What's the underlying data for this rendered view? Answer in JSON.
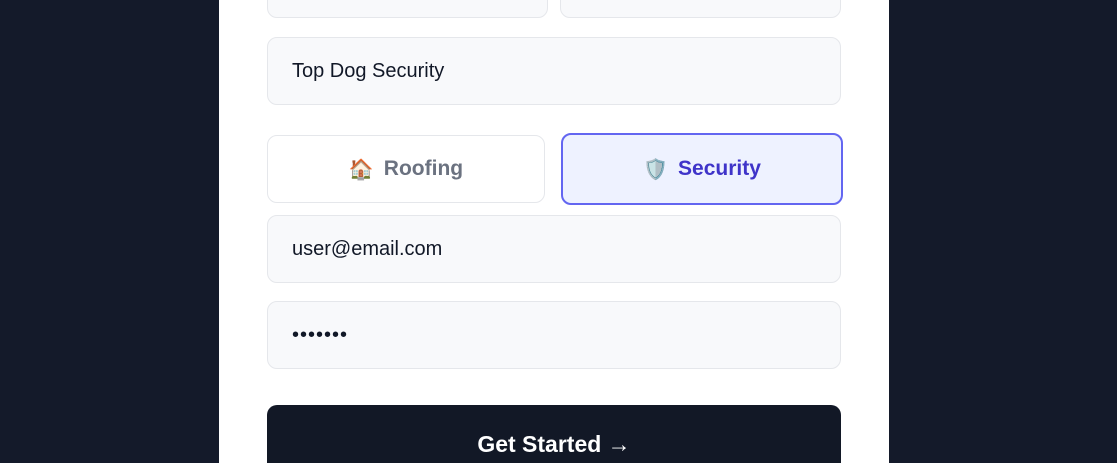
{
  "form": {
    "top_left_field": {
      "value": ""
    },
    "top_right_field": {
      "value": ""
    },
    "company_field": {
      "value": "Top Dog Security"
    },
    "industry_options": [
      {
        "label": "Roofing",
        "icon": "house-icon",
        "emoji": "🏠",
        "selected": false
      },
      {
        "label": "Security",
        "icon": "shield-icon",
        "emoji": "🛡️",
        "selected": true
      }
    ],
    "email_field": {
      "value": "user@email.com"
    },
    "password_field": {
      "value": "•••••••"
    },
    "submit_label": "Get Started →"
  },
  "colors": {
    "background": "#141a2a",
    "card": "#ffffff",
    "field_bg": "#f8f9fb",
    "accent": "#6366f1",
    "accent_text": "#3f34c9",
    "button_bg": "#121826"
  }
}
